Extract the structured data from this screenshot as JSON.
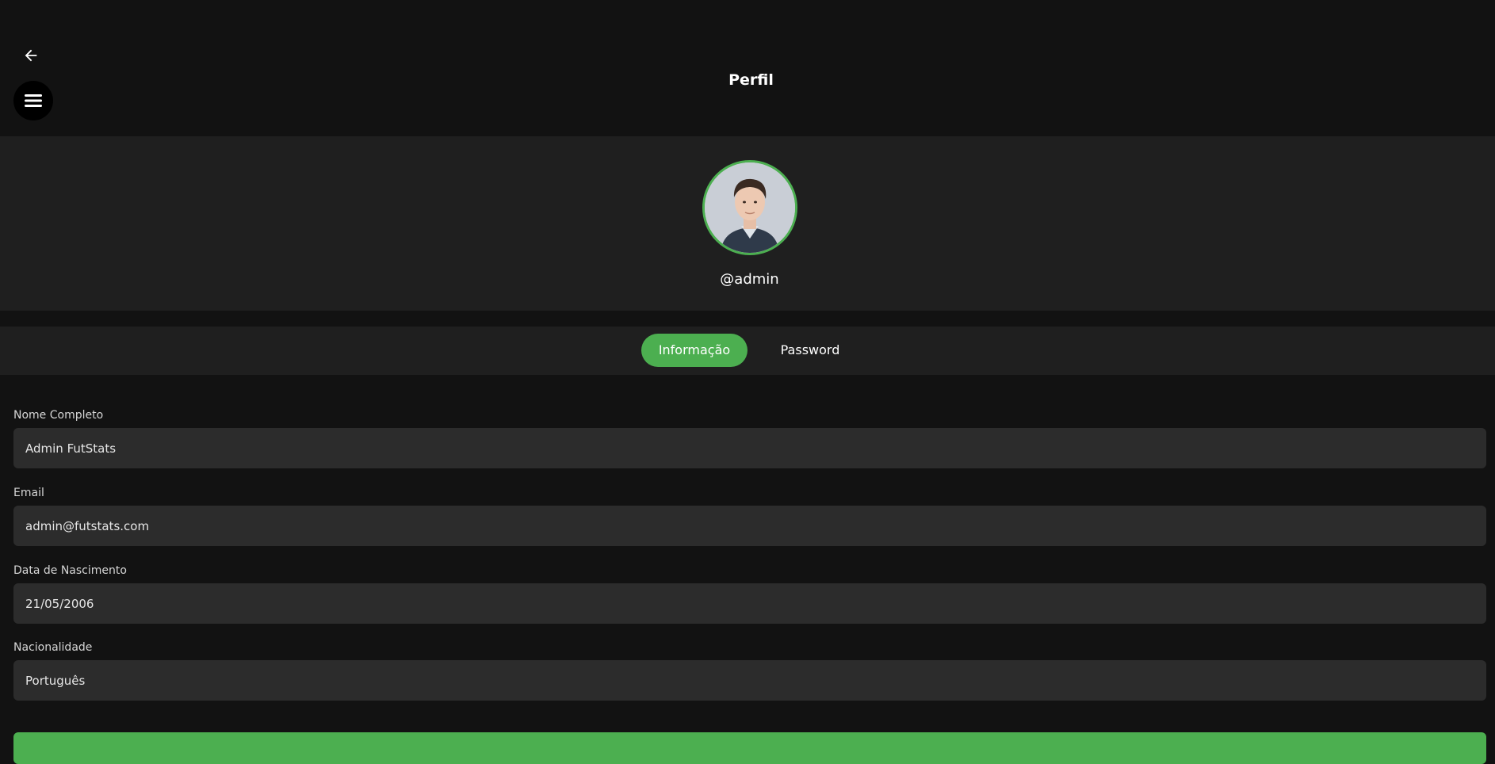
{
  "header": {
    "title": "Perfil",
    "back_icon": "arrow-left-icon",
    "menu_icon": "hamburger-menu-icon"
  },
  "profile": {
    "username": "@admin",
    "avatar_icon": "avatar-photo",
    "accent_color": "#4caf50"
  },
  "tabs": [
    {
      "label": "Informação",
      "active": true
    },
    {
      "label": "Password",
      "active": false
    }
  ],
  "form": {
    "full_name": {
      "label": "Nome Completo",
      "value": "Admin FutStats"
    },
    "email": {
      "label": "Email",
      "value": "admin@futstats.com"
    },
    "birth_date": {
      "label": "Data de Nascimento",
      "value": "21/05/2006"
    },
    "nationality": {
      "label": "Nacionalidade",
      "value": "Português"
    }
  },
  "colors": {
    "background": "#121212",
    "panel": "#1f1f1f",
    "input": "#2c2c2c",
    "accent": "#4caf50"
  }
}
